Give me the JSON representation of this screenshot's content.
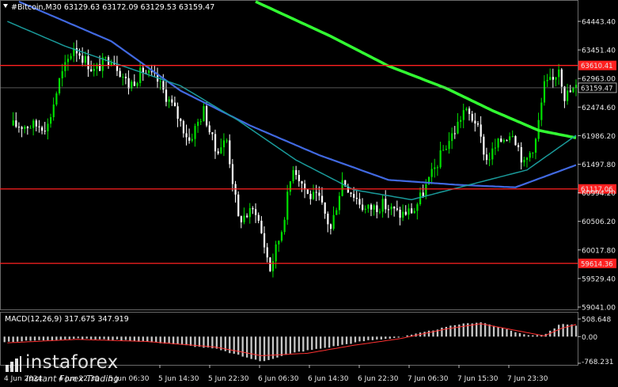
{
  "header": {
    "symbol": "#Bitcoin,M30",
    "ohlc": "63129.63 63172.09 63129.53 63159.47"
  },
  "macd_header": "MACD(12,26,9) 317.675 347.919",
  "watermark": {
    "name": "instaforex",
    "tagline": "Instant Forex Trading"
  },
  "colors": {
    "background": "#000000",
    "bull_candle": "#00e000",
    "bear_candle": "#ffffff",
    "ma_fast": "#1a9a9a",
    "ma_mid": "#4169e1",
    "ma_slow": "#32ff32",
    "level": "#ff2020",
    "macd_hist": "#c8c8c8",
    "macd_signal": "#ff3030"
  },
  "chart_data": [
    {
      "type": "candlestick",
      "title": "#Bitcoin,M30",
      "ylim": [
        58700,
        64900
      ],
      "y_ticks": [
        "64443.40",
        "63451.40",
        "62963.00",
        "62474.60",
        "61986.20",
        "61497.80",
        "60994.20",
        "60506.20",
        "60017.80",
        "59529.40",
        "59041.00"
      ],
      "x_labels": [
        "4 Jun 2024",
        "4 Jun 22:30",
        "5 Jun 06:30",
        "5 Jun 14:30",
        "5 Jun 22:30",
        "6 Jun 06:30",
        "6 Jun 14:30",
        "6 Jun 22:30",
        "7 Jun 06:30",
        "7 Jun 15:30",
        "7 Jun 23:30"
      ],
      "price_series": [
        {
          "t": "4 Jun 07:00",
          "v": 62400
        },
        {
          "t": "4 Jun 09:00",
          "v": 63300
        },
        {
          "t": "4 Jun 11:30",
          "v": 64000
        },
        {
          "t": "4 Jun 15:00",
          "v": 63500
        },
        {
          "t": "4 Jun 18:00",
          "v": 63800
        },
        {
          "t": "4 Jun 21:00",
          "v": 63200
        },
        {
          "t": "4 Jun 23:30",
          "v": 63500
        },
        {
          "t": "5 Jun 02:00",
          "v": 63300
        },
        {
          "t": "5 Jun 05:00",
          "v": 62700
        },
        {
          "t": "5 Jun 07:30",
          "v": 62100
        },
        {
          "t": "5 Jun 10:00",
          "v": 62700
        },
        {
          "t": "5 Jun 12:00",
          "v": 61900
        },
        {
          "t": "5 Jun 14:00",
          "v": 62100
        },
        {
          "t": "5 Jun 16:00",
          "v": 60500
        },
        {
          "t": "5 Jun 19:00",
          "v": 60700
        },
        {
          "t": "5 Jun 21:30",
          "v": 59500
        },
        {
          "t": "5 Jun 23:30",
          "v": 60300
        },
        {
          "t": "6 Jun 01:30",
          "v": 61600
        },
        {
          "t": "6 Jun 04:00",
          "v": 61000
        },
        {
          "t": "6 Jun 06:00",
          "v": 60900
        },
        {
          "t": "6 Jun 08:00",
          "v": 60300
        },
        {
          "t": "6 Jun 10:00",
          "v": 61300
        },
        {
          "t": "6 Jun 12:00",
          "v": 61000
        },
        {
          "t": "6 Jun 14:00",
          "v": 60700
        },
        {
          "t": "6 Jun 17:00",
          "v": 60800
        },
        {
          "t": "6 Jun 20:00",
          "v": 60600
        },
        {
          "t": "6 Jun 22:30",
          "v": 60700
        },
        {
          "t": "7 Jun 01:30",
          "v": 61400
        },
        {
          "t": "7 Jun 03:30",
          "v": 61900
        },
        {
          "t": "7 Jun 05:30",
          "v": 62300
        },
        {
          "t": "7 Jun 07:00",
          "v": 62700
        },
        {
          "t": "7 Jun 09:00",
          "v": 62500
        },
        {
          "t": "7 Jun 11:00",
          "v": 61700
        },
        {
          "t": "7 Jun 13:30",
          "v": 62100
        },
        {
          "t": "7 Jun 15:30",
          "v": 62300
        },
        {
          "t": "7 Jun 17:30",
          "v": 61600
        },
        {
          "t": "7 Jun 19:30",
          "v": 62100
        },
        {
          "t": "7 Jun 21:00",
          "v": 63200
        },
        {
          "t": "7 Jun 22:30",
          "v": 63300
        },
        {
          "t": "7 Jun 23:30",
          "v": 63600
        },
        {
          "t": "8 Jun 00:30",
          "v": 63000
        },
        {
          "t": "8 Jun 02:30",
          "v": 63150
        }
      ],
      "moving_averages": [
        {
          "color": "#32ff32",
          "points": [
            {
              "t": "5 Jun 19:00",
              "v": 64900
            },
            {
              "t": "6 Jun 08:00",
              "v": 64200
            },
            {
              "t": "6 Jun 18:00",
              "v": 63600
            },
            {
              "t": "7 Jun 04:00",
              "v": 63150
            },
            {
              "t": "7 Jun 12:00",
              "v": 62700
            },
            {
              "t": "7 Jun 20:00",
              "v": 62300
            },
            {
              "t": "8 Jun 02:30",
              "v": 62150
            }
          ]
        },
        {
          "color": "#4169e1",
          "points": [
            {
              "t": "4 Jun 02:00",
              "v": 64900
            },
            {
              "t": "4 Jun 18:00",
              "v": 64100
            },
            {
              "t": "5 Jun 06:00",
              "v": 63100
            },
            {
              "t": "5 Jun 18:00",
              "v": 62400
            },
            {
              "t": "6 Jun 06:00",
              "v": 61800
            },
            {
              "t": "6 Jun 18:00",
              "v": 61300
            },
            {
              "t": "7 Jun 06:00",
              "v": 61200
            },
            {
              "t": "7 Jun 16:00",
              "v": 61150
            },
            {
              "t": "8 Jun 02:30",
              "v": 61600
            }
          ]
        },
        {
          "color": "#1a9a9a",
          "points": [
            {
              "t": "4 Jun 00:00",
              "v": 64500
            },
            {
              "t": "4 Jun 10:00",
              "v": 64000
            },
            {
              "t": "4 Jun 20:00",
              "v": 63600
            },
            {
              "t": "5 Jun 06:00",
              "v": 63200
            },
            {
              "t": "5 Jun 16:00",
              "v": 62500
            },
            {
              "t": "6 Jun 02:00",
              "v": 61700
            },
            {
              "t": "6 Jun 12:00",
              "v": 61100
            },
            {
              "t": "6 Jun 22:00",
              "v": 60900
            },
            {
              "t": "7 Jun 08:00",
              "v": 61200
            },
            {
              "t": "7 Jun 18:00",
              "v": 61500
            },
            {
              "t": "8 Jun 02:30",
              "v": 62200
            }
          ]
        }
      ],
      "levels": [
        {
          "value": 63610.41,
          "label": "63610.41",
          "color": "#ff2020"
        },
        {
          "value": 61117.06,
          "label": "61117.06",
          "color": "#ff2020"
        },
        {
          "value": 59614.36,
          "label": "59614.36",
          "color": "#ff2020"
        }
      ],
      "current_price": {
        "value": 63159.47,
        "label": "63159.47"
      }
    },
    {
      "type": "bar",
      "title": "MACD(12,26,9) 317.675 347.919",
      "ylim": [
        -768.231,
        508.648
      ],
      "y_ticks": [
        "508.648",
        "0.00",
        "-768.231"
      ],
      "histogram_series": [
        {
          "t": "4 Jun 00:00",
          "v": -150
        },
        {
          "t": "4 Jun 12:00",
          "v": -60
        },
        {
          "t": "4 Jun 20:00",
          "v": -100
        },
        {
          "t": "5 Jun 04:00",
          "v": -200
        },
        {
          "t": "5 Jun 12:00",
          "v": -350
        },
        {
          "t": "5 Jun 20:00",
          "v": -720
        },
        {
          "t": "6 Jun 02:00",
          "v": -450
        },
        {
          "t": "6 Jun 08:00",
          "v": -300
        },
        {
          "t": "6 Jun 14:00",
          "v": -120
        },
        {
          "t": "6 Jun 20:00",
          "v": -20
        },
        {
          "t": "7 Jun 00:00",
          "v": 120
        },
        {
          "t": "7 Jun 06:00",
          "v": 350
        },
        {
          "t": "7 Jun 10:00",
          "v": 420
        },
        {
          "t": "7 Jun 14:00",
          "v": 230
        },
        {
          "t": "7 Jun 18:00",
          "v": 40
        },
        {
          "t": "7 Jun 21:00",
          "v": 60
        },
        {
          "t": "8 Jun 00:00",
          "v": 380
        },
        {
          "t": "8 Jun 02:30",
          "v": 318
        }
      ],
      "signal_series": [
        {
          "t": "4 Jun 00:00",
          "v": -180
        },
        {
          "t": "4 Jun 12:00",
          "v": -80
        },
        {
          "t": "5 Jun 00:00",
          "v": -140
        },
        {
          "t": "5 Jun 12:00",
          "v": -300
        },
        {
          "t": "5 Jun 20:00",
          "v": -550
        },
        {
          "t": "6 Jun 04:00",
          "v": -480
        },
        {
          "t": "6 Jun 12:00",
          "v": -250
        },
        {
          "t": "6 Jun 20:00",
          "v": -60
        },
        {
          "t": "7 Jun 04:00",
          "v": 220
        },
        {
          "t": "7 Jun 10:00",
          "v": 370
        },
        {
          "t": "7 Jun 16:00",
          "v": 180
        },
        {
          "t": "7 Jun 21:00",
          "v": 20
        },
        {
          "t": "8 Jun 00:00",
          "v": 240
        },
        {
          "t": "8 Jun 02:30",
          "v": 348
        }
      ]
    }
  ]
}
